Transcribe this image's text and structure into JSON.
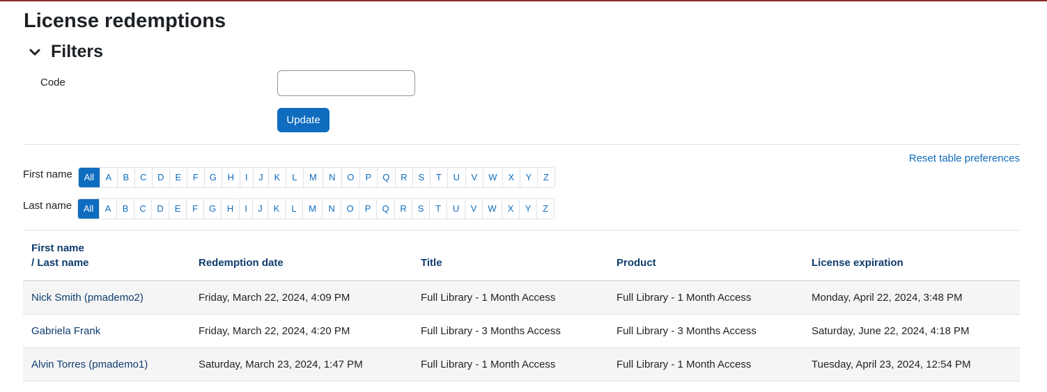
{
  "page": {
    "title": "License redemptions"
  },
  "filters": {
    "heading": "Filters",
    "code_label": "Code",
    "code_value": "",
    "update_label": "Update"
  },
  "reset_link": "Reset table preferences",
  "initials": {
    "first_label": "First name",
    "last_label": "Last name",
    "letters": [
      "All",
      "A",
      "B",
      "C",
      "D",
      "E",
      "F",
      "G",
      "H",
      "I",
      "J",
      "K",
      "L",
      "M",
      "N",
      "O",
      "P",
      "Q",
      "R",
      "S",
      "T",
      "U",
      "V",
      "W",
      "X",
      "Y",
      "Z"
    ],
    "selected": "All"
  },
  "table": {
    "headers": {
      "first_name": "First name",
      "last_name": "/ Last name",
      "redemption_date": "Redemption date",
      "title": "Title",
      "product": "Product",
      "license_expiration": "License expiration"
    },
    "rows": [
      {
        "name": "Nick Smith (pmademo2)",
        "redemption_date": "Friday, March 22, 2024, 4:09 PM",
        "title": "Full Library - 1 Month Access",
        "product": "Full Library - 1 Month Access",
        "license_expiration": "Monday, April 22, 2024, 3:48 PM"
      },
      {
        "name": "Gabriela Frank",
        "redemption_date": "Friday, March 22, 2024, 4:20 PM",
        "title": "Full Library - 3 Months Access",
        "product": "Full Library - 3 Months Access",
        "license_expiration": "Saturday, June 22, 2024, 4:18 PM"
      },
      {
        "name": "Alvin Torres (pmademo1)",
        "redemption_date": "Saturday, March 23, 2024, 1:47 PM",
        "title": "Full Library - 1 Month Access",
        "product": "Full Library - 1 Month Access",
        "license_expiration": "Tuesday, April 23, 2024, 12:54 PM"
      }
    ]
  },
  "colors": {
    "accent": "#0f6cbf",
    "header_link": "#0f3c6e",
    "top_border": "#8f2a2a"
  },
  "icons": {
    "filters_toggle": "chevron-down-icon"
  }
}
